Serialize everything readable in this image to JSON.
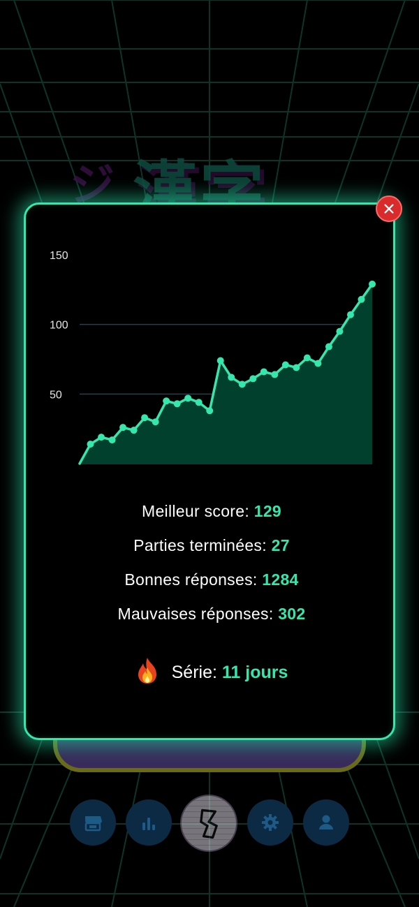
{
  "title_logo": {
    "mark": "ジ",
    "text": "漢字"
  },
  "chart_data": {
    "type": "area",
    "x": [
      1,
      2,
      3,
      4,
      5,
      6,
      7,
      8,
      9,
      10,
      11,
      12,
      13,
      14,
      15,
      16,
      17,
      18,
      19,
      20,
      21,
      22,
      23,
      24,
      25,
      26,
      27,
      28
    ],
    "values": [
      0,
      14,
      19,
      17,
      26,
      24,
      33,
      30,
      45,
      43,
      47,
      44,
      38,
      74,
      62,
      57,
      61,
      66,
      64,
      71,
      69,
      76,
      72,
      84,
      95,
      107,
      118,
      129
    ],
    "yticks": [
      50,
      100,
      150
    ],
    "ylim": [
      0,
      150
    ],
    "line_color": "#35e7ad",
    "fill_color": "#00402c",
    "grid": true
  },
  "stats": {
    "best_score": {
      "label": "Meilleur score: ",
      "value": "129"
    },
    "games_finished": {
      "label": "Parties terminées: ",
      "value": "27"
    },
    "good_answers": {
      "label": "Bonnes réponses: ",
      "value": "1284"
    },
    "bad_answers": {
      "label": "Mauvaises réponses: ",
      "value": "302"
    }
  },
  "streak": {
    "label": "Série: ",
    "value": "11 jours",
    "icon": "fire-icon"
  },
  "close_button": {
    "icon": "close-icon",
    "color": "#d92b2b"
  },
  "nav": [
    {
      "icon": "shop-icon"
    },
    {
      "icon": "stats-icon"
    },
    {
      "icon": "play-kanji-icon"
    },
    {
      "icon": "gear-icon"
    },
    {
      "icon": "user-icon"
    }
  ],
  "colors": {
    "accent": "#35e7ad",
    "nav_button": "#0c2a44",
    "nav_icon": "#1e5a86"
  }
}
